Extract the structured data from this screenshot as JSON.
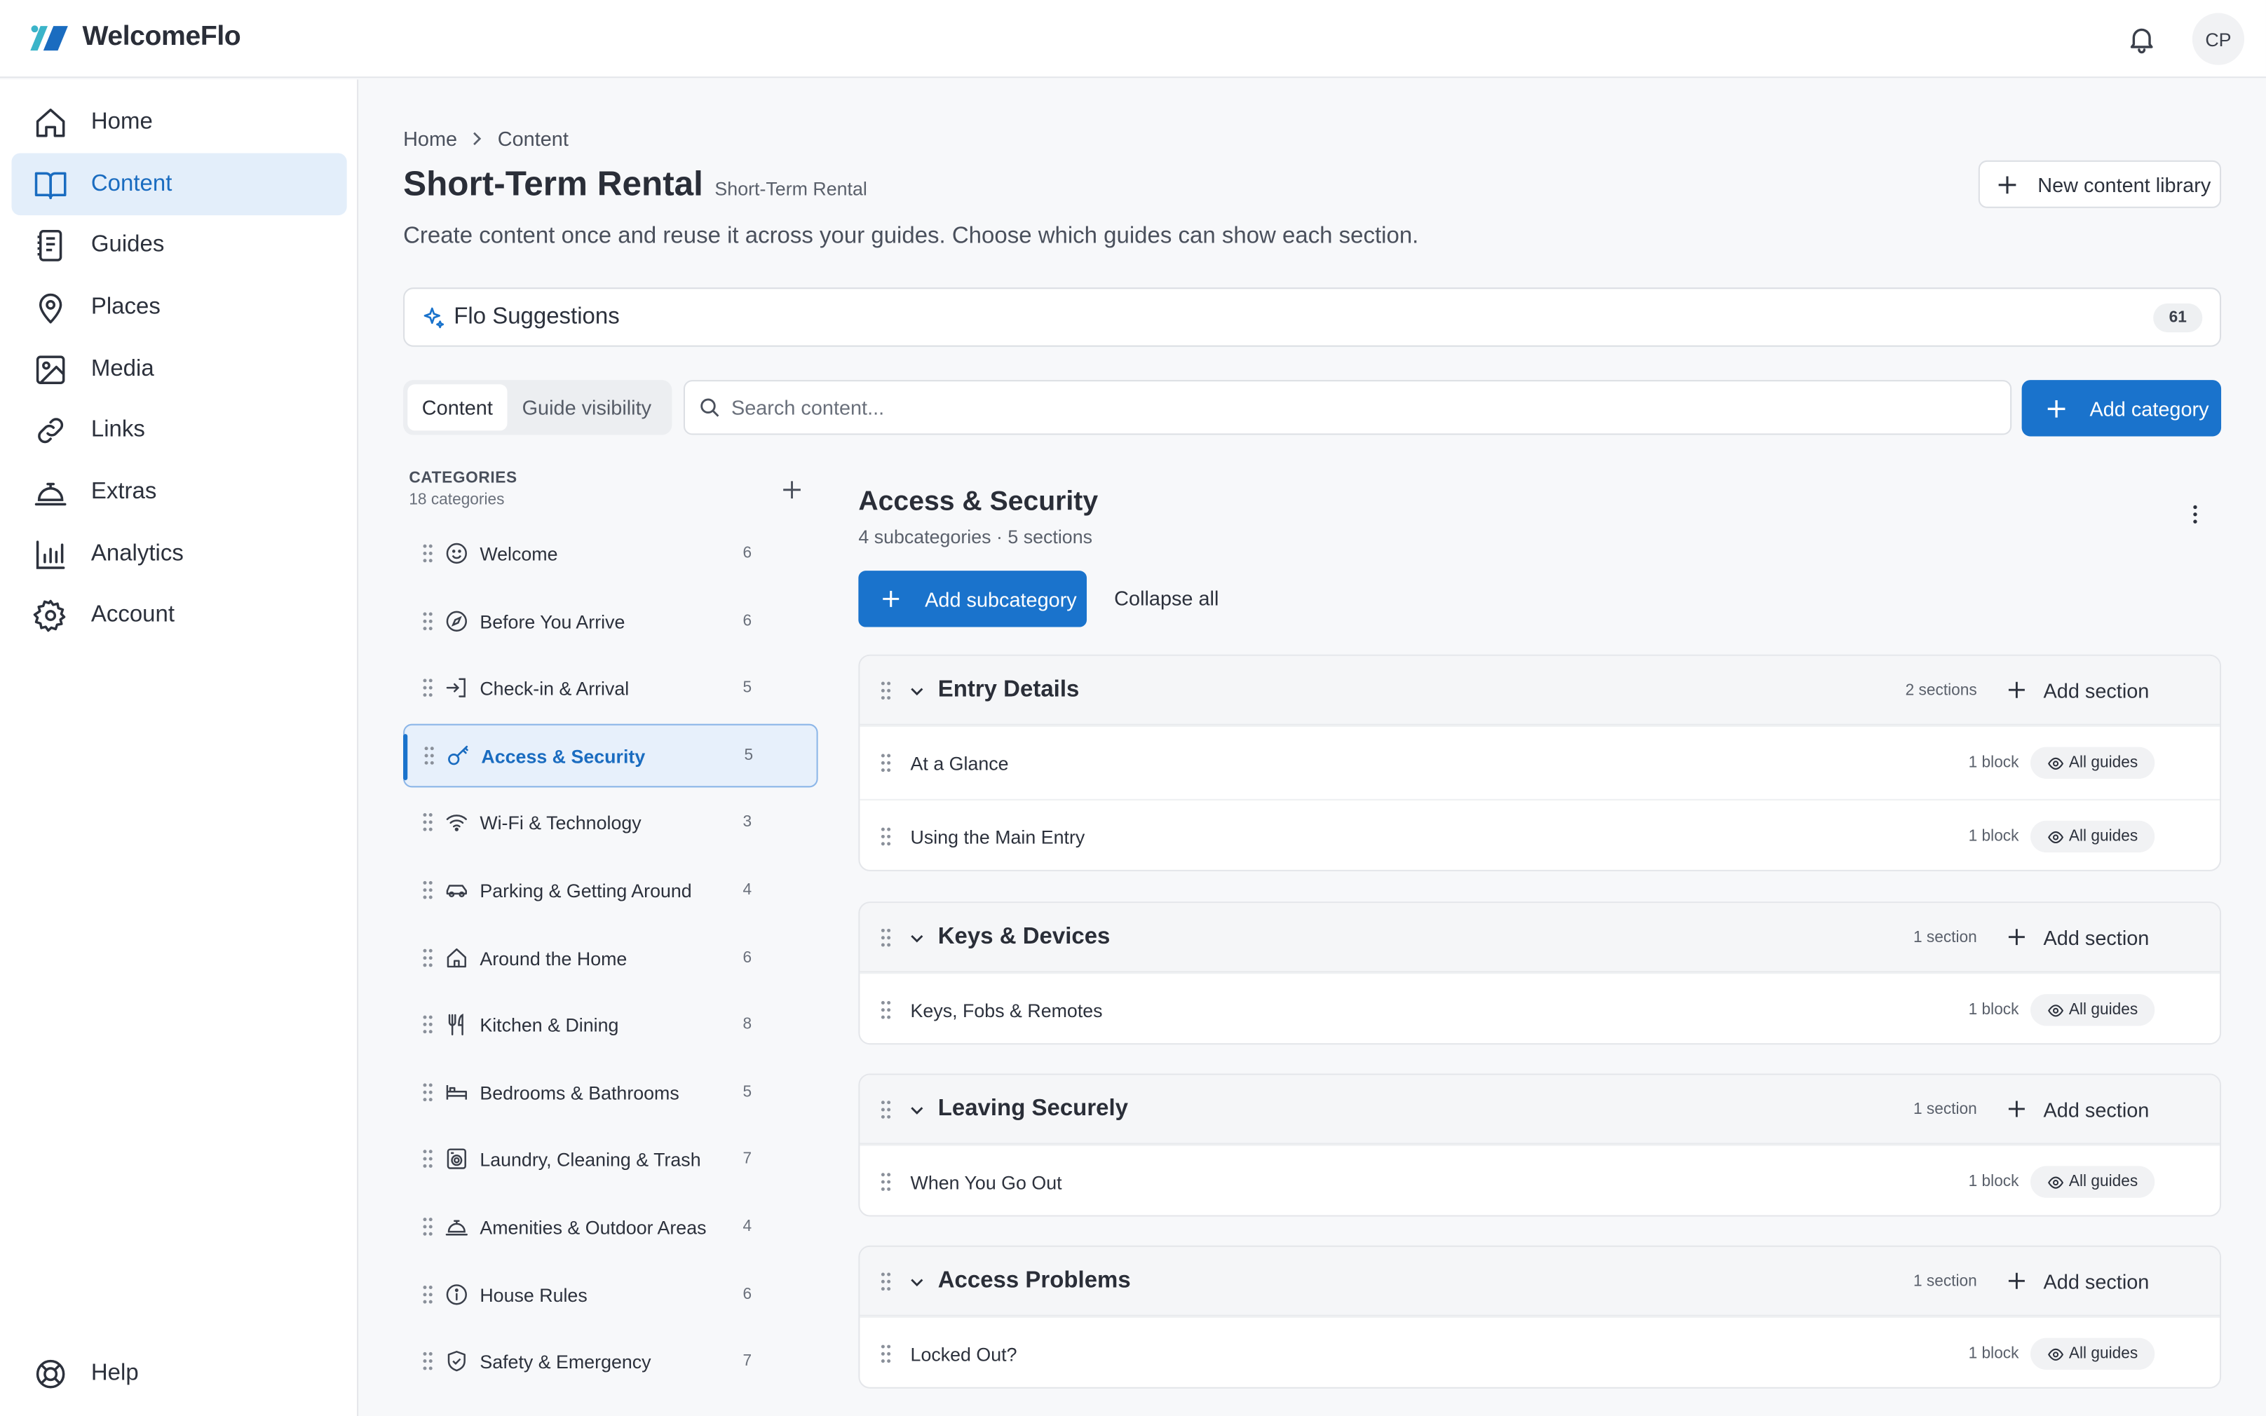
{
  "app": {
    "name": "WelcomeFlo",
    "user_initials": "CP"
  },
  "nav": {
    "items": [
      {
        "label": "Home",
        "icon": "home-icon"
      },
      {
        "label": "Content",
        "icon": "book-icon",
        "active": true
      },
      {
        "label": "Guides",
        "icon": "guides-icon"
      },
      {
        "label": "Places",
        "icon": "map-pin-icon"
      },
      {
        "label": "Media",
        "icon": "image-icon"
      },
      {
        "label": "Links",
        "icon": "link-icon"
      },
      {
        "label": "Extras",
        "icon": "bell-service-icon"
      },
      {
        "label": "Analytics",
        "icon": "bar-chart-icon"
      },
      {
        "label": "Account",
        "icon": "gear-icon"
      }
    ],
    "help": "Help"
  },
  "breadcrumb": {
    "home": "Home",
    "current": "Content"
  },
  "page": {
    "title": "Short-Term Rental",
    "subtitle": "Short-Term Rental",
    "description": "Create content once and reuse it across your guides. Choose which guides can show each section.",
    "new_library_label": "New content library"
  },
  "flo": {
    "label": "Flo Suggestions",
    "count": "61"
  },
  "tabs": {
    "content": "Content",
    "visibility": "Guide visibility"
  },
  "search": {
    "placeholder": "Search content..."
  },
  "add_category_label": "Add category",
  "categories": {
    "heading": "CATEGORIES",
    "count_label": "18 categories",
    "items": [
      {
        "label": "Welcome",
        "count": "6",
        "icon": "smile-icon"
      },
      {
        "label": "Before You Arrive",
        "count": "6",
        "icon": "compass-icon"
      },
      {
        "label": "Check-in & Arrival",
        "count": "5",
        "icon": "login-icon"
      },
      {
        "label": "Access & Security",
        "count": "5",
        "icon": "key-icon",
        "selected": true
      },
      {
        "label": "Wi-Fi & Technology",
        "count": "3",
        "icon": "wifi-icon"
      },
      {
        "label": "Parking & Getting Around",
        "count": "4",
        "icon": "car-icon"
      },
      {
        "label": "Around the Home",
        "count": "6",
        "icon": "house-icon"
      },
      {
        "label": "Kitchen & Dining",
        "count": "8",
        "icon": "utensils-icon"
      },
      {
        "label": "Bedrooms & Bathrooms",
        "count": "5",
        "icon": "bed-icon"
      },
      {
        "label": "Laundry, Cleaning & Trash",
        "count": "7",
        "icon": "washer-icon"
      },
      {
        "label": "Amenities & Outdoor Areas",
        "count": "4",
        "icon": "bell-service-icon"
      },
      {
        "label": "House Rules",
        "count": "6",
        "icon": "info-icon"
      },
      {
        "label": "Safety & Emergency",
        "count": "7",
        "icon": "shield-icon"
      }
    ]
  },
  "detail": {
    "title": "Access & Security",
    "meta": "4 subcategories · 5 sections",
    "add_subcategory_label": "Add subcategory",
    "collapse_label": "Collapse all",
    "add_section_label": "Add section",
    "subcategories": [
      {
        "name": "Entry Details",
        "count": "2 sections",
        "sections": [
          {
            "name": "At a Glance",
            "blocks": "1 block",
            "visibility": "All guides"
          },
          {
            "name": "Using the Main Entry",
            "blocks": "1 block",
            "visibility": "All guides"
          }
        ]
      },
      {
        "name": "Keys & Devices",
        "count": "1 section",
        "sections": [
          {
            "name": "Keys, Fobs & Remotes",
            "blocks": "1 block",
            "visibility": "All guides"
          }
        ]
      },
      {
        "name": "Leaving Securely",
        "count": "1 section",
        "sections": [
          {
            "name": "When You Go Out",
            "blocks": "1 block",
            "visibility": "All guides"
          }
        ]
      },
      {
        "name": "Access Problems",
        "count": "1 section",
        "sections": [
          {
            "name": "Locked Out?",
            "blocks": "1 block",
            "visibility": "All guides"
          }
        ]
      }
    ]
  },
  "colors": {
    "accent": "#1a73cc",
    "selected_bg": "#e7f0fb"
  }
}
